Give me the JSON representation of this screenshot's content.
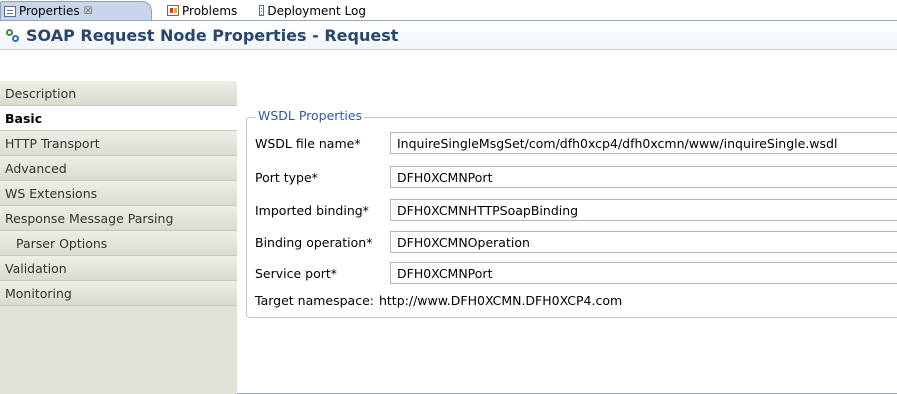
{
  "tabs": [
    {
      "label": "Properties",
      "close": "☒"
    },
    {
      "label": "Problems"
    },
    {
      "label": "Deployment Log"
    }
  ],
  "title": "SOAP Request Node Properties - Request",
  "sidebar": {
    "items": [
      {
        "label": "Description"
      },
      {
        "label": "Basic"
      },
      {
        "label": "HTTP Transport"
      },
      {
        "label": "Advanced"
      },
      {
        "label": "WS Extensions"
      },
      {
        "label": "Response Message Parsing"
      },
      {
        "label": "Parser Options"
      },
      {
        "label": "Validation"
      },
      {
        "label": "Monitoring"
      }
    ]
  },
  "wsdl": {
    "legend": "WSDL Properties",
    "fields": [
      {
        "label": "WSDL file name*",
        "value": "InquireSingleMsgSet/com/dfh0xcp4/dfh0xcmn/www/inquireSingle.wsdl"
      },
      {
        "label": "Port type*",
        "value": "DFH0XCMNPort"
      },
      {
        "label": "Imported binding*",
        "value": "DFH0XCMNHTTPSoapBinding"
      },
      {
        "label": "Binding operation*",
        "value": "DFH0XCMNOperation"
      },
      {
        "label": "Service port*",
        "value": "DFH0XCMNPort"
      }
    ],
    "namespace": {
      "label": "Target namespace:",
      "value": "http://www.DFH0XCMN.DFH0XCP4.com"
    }
  }
}
